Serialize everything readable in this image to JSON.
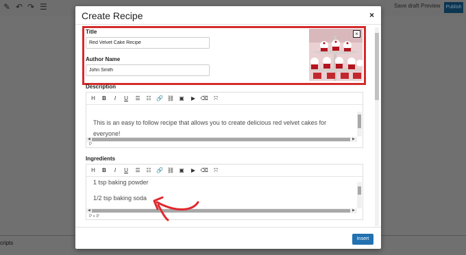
{
  "background": {
    "save_draft": "Save draft",
    "preview": "Preview",
    "publish": "Publish",
    "footer_text": "cripts"
  },
  "modal": {
    "title": "Create Recipe",
    "close_glyph": "×",
    "title_label": "Title",
    "title_value": "Red Velvet Cake Recipe",
    "author_label": "Author Name",
    "author_value": "John Smith",
    "image_close_glyph": "×",
    "description": {
      "label": "Description",
      "line1": "This is an easy to follow recipe that allows you to create delicious red velvet cakes for",
      "line2": "everyone!",
      "status": "P"
    },
    "ingredients": {
      "label": "Ingredients",
      "line1": "1 tsp baking powder",
      "line2": "1/2 tsp baking soda",
      "status": "P » P"
    },
    "insert_label": "Insert",
    "toolbar": [
      {
        "icon": "heading-icon",
        "glyph": "H"
      },
      {
        "icon": "bold-icon",
        "glyph": "B"
      },
      {
        "icon": "italic-icon",
        "glyph": "I"
      },
      {
        "icon": "underline-icon",
        "glyph": "U"
      },
      {
        "icon": "bullet-list-icon",
        "glyph": "☰"
      },
      {
        "icon": "numbered-list-icon",
        "glyph": "☷"
      },
      {
        "icon": "link-icon",
        "glyph": "🔗"
      },
      {
        "icon": "unlink-icon",
        "glyph": "⛓"
      },
      {
        "icon": "image-icon",
        "glyph": "▣"
      },
      {
        "icon": "video-icon",
        "glyph": "▶"
      },
      {
        "icon": "eraser-icon",
        "glyph": "⌫"
      },
      {
        "icon": "fullscreen-icon",
        "glyph": "⤧"
      }
    ]
  },
  "colors": {
    "accent": "#2271b1",
    "highlight": "#d42a2a",
    "annotation": "#e0282f"
  }
}
